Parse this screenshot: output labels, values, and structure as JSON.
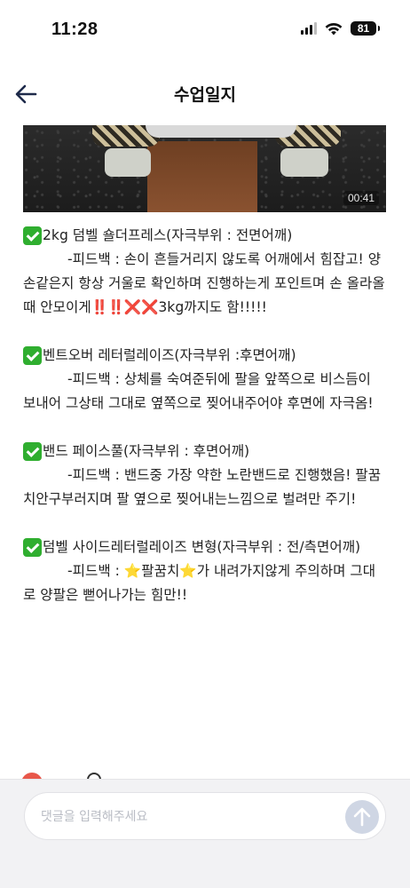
{
  "status_bar": {
    "time": "11:28",
    "battery": "81"
  },
  "header": {
    "title": "수업일지"
  },
  "video": {
    "duration": "00:41"
  },
  "sections": [
    {
      "title": "2kg 덤벨 숄더프레스(자극부위 : 전면어깨)",
      "feedback_text": "-피드백 : 손이 흔들거리지 않도록 어깨에서 힘잡고! 양손같은지 항상 거울로 확인하며 진행하는게 포인트며 손 올라올때 안모이게",
      "feedback_emph_bang": "‼️‼️",
      "feedback_emph_cross": "❌❌",
      "feedback_end": "3kg까지도 함!!!!!"
    },
    {
      "title": "벤트오버 레터럴레이즈(자극부위 :후면어깨)",
      "feedback_text": " -피드백 : 상체를 숙여준뒤에 팔을 앞쪽으로 비스듬이 보내어 그상태 그대로 옆쪽으로 찢어내주어야 후면에 자극옴!"
    },
    {
      "title": "밴드 페이스풀(자극부위 : 후면어깨)",
      "feedback_text": "-피드백 : 밴드중 가장 약한 노란밴드로 진행했음! 팔꿈치안구부러지며 팔 옆으로 찢어내는느낌으로 벌려만 주기!"
    },
    {
      "title": "덤벨 사이드레터럴레이즈 변형(자극부위 : 전/측면어깨)",
      "feedback_pre": "-피드백 : ",
      "star": "⭐",
      "feedback_mid": "팔꿈치",
      "feedback_post": "가 내려가지않게 주의하며 그대로 양팔은 뻗어나가는 힘만!!"
    }
  ],
  "comment": {
    "placeholder": "댓글을 입력해주세요"
  },
  "colors": {
    "check": "#2fae2f",
    "accent_send": "#cfd6e4",
    "heart": "#e8574a"
  }
}
